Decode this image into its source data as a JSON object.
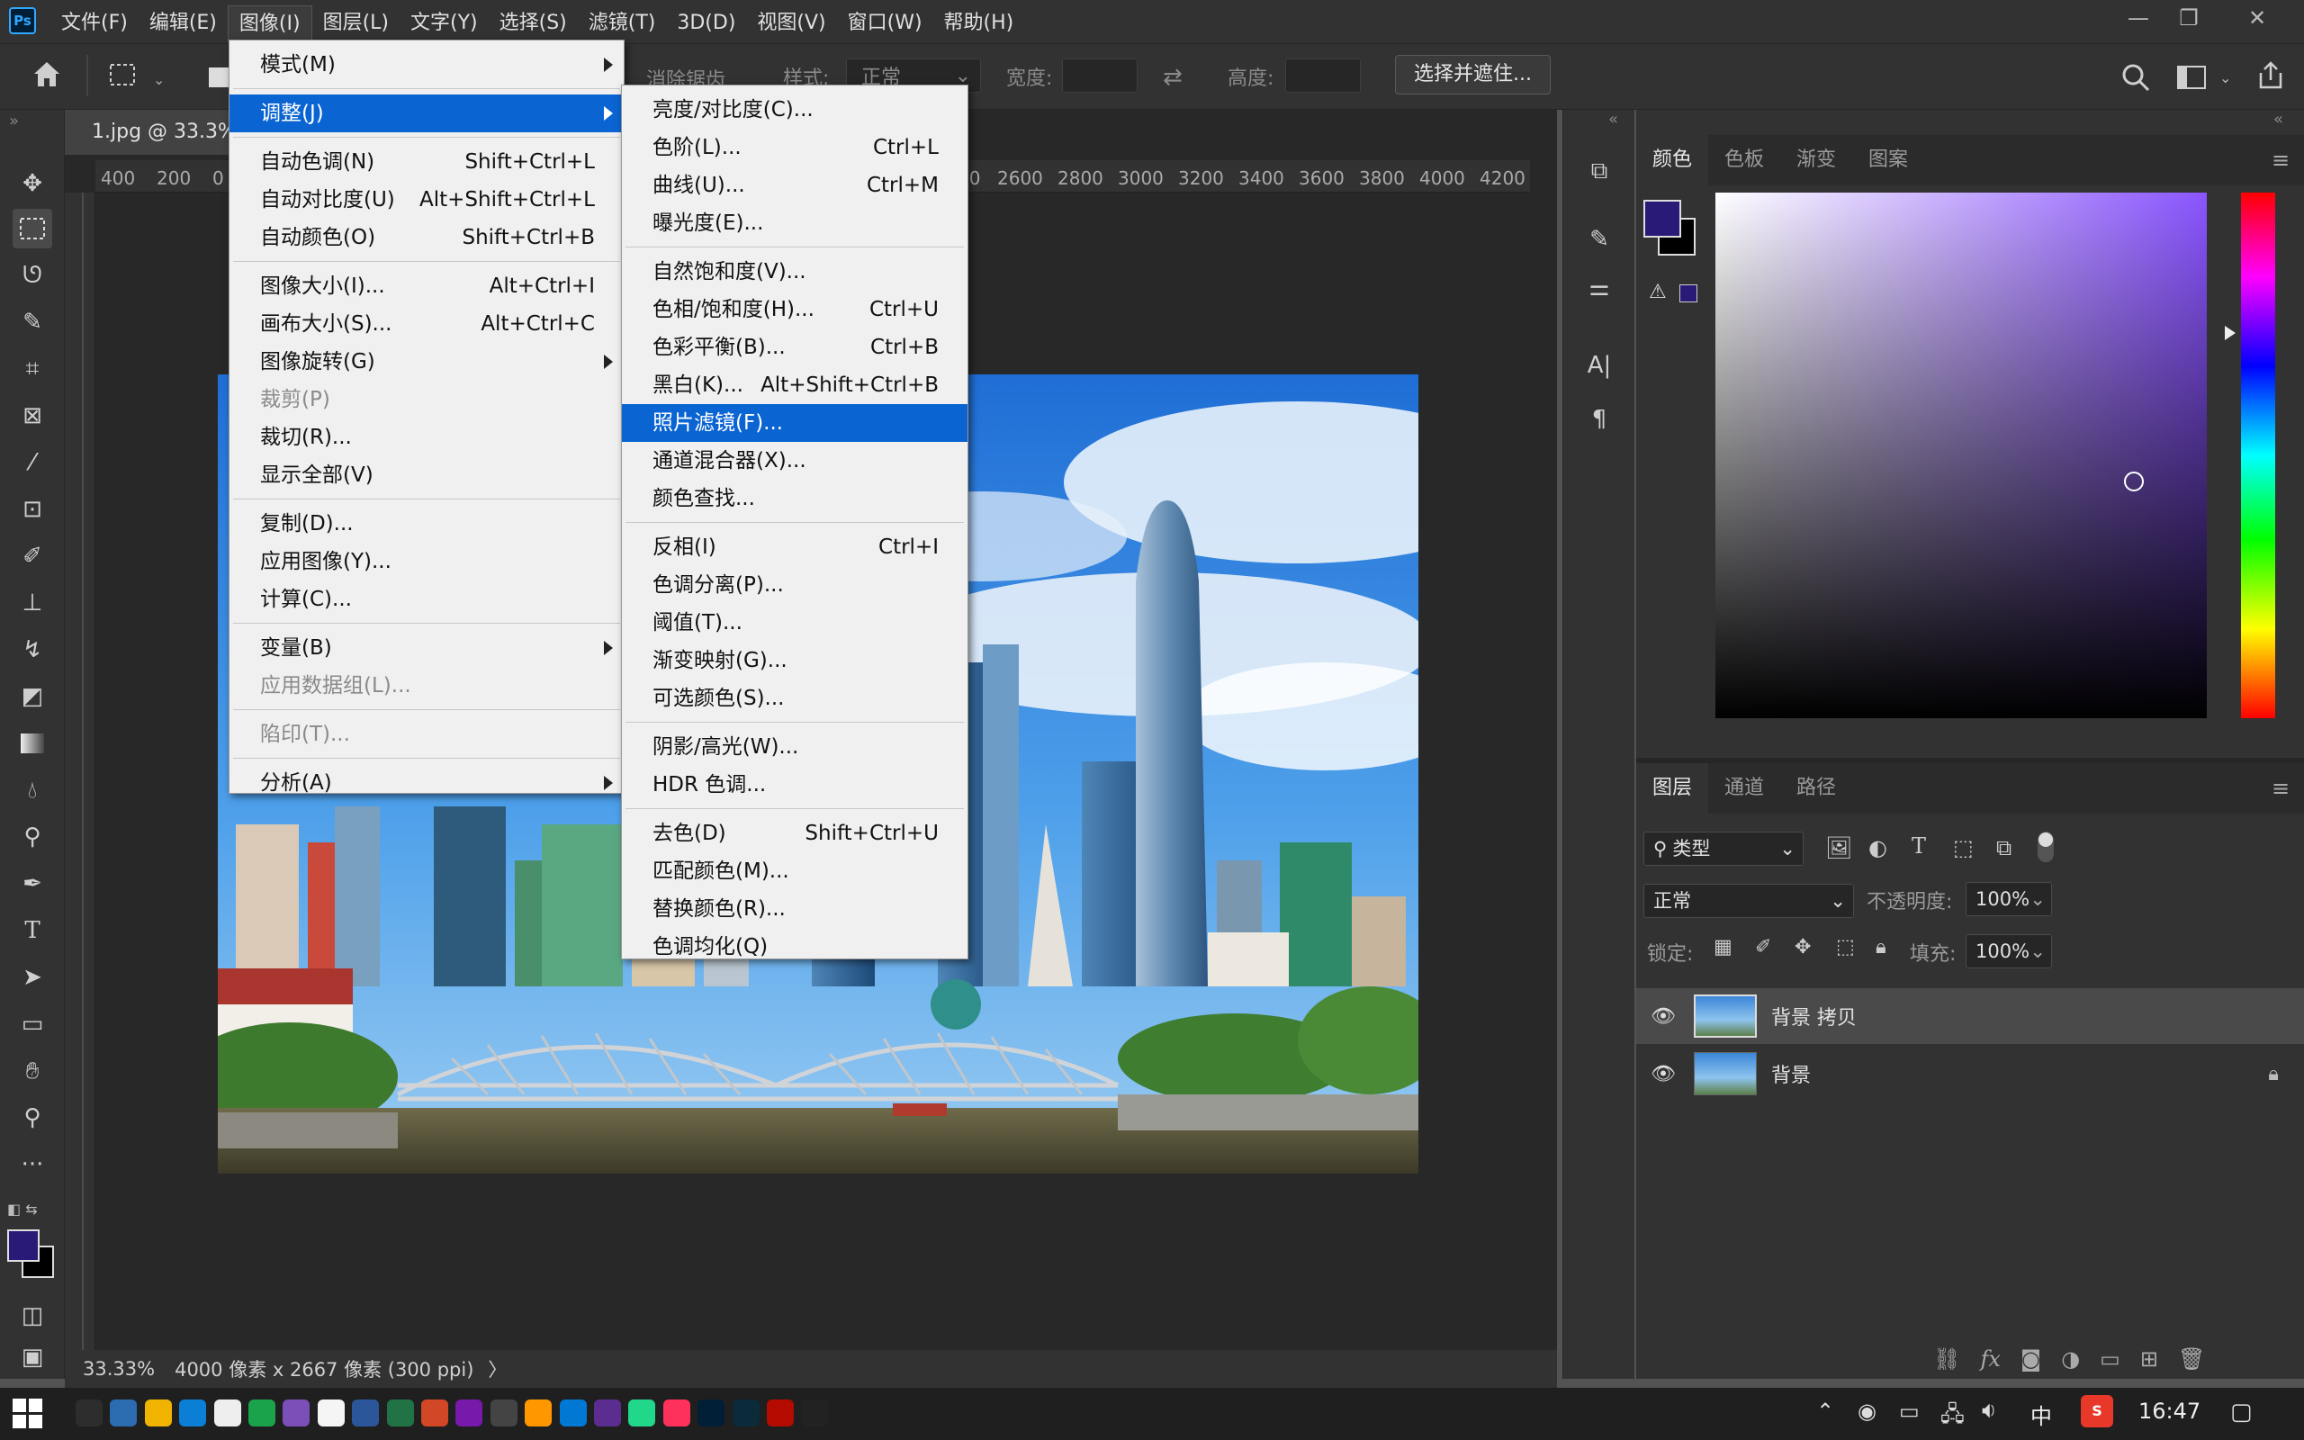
{
  "app": {
    "logo": "Ps"
  },
  "menubar": {
    "items": [
      "文件(F)",
      "编辑(E)",
      "图像(I)",
      "图层(L)",
      "文字(Y)",
      "选择(S)",
      "滤镜(T)",
      "3D(D)",
      "视图(V)",
      "窗口(W)",
      "帮助(H)"
    ],
    "active_index": 2,
    "window_controls": [
      "—",
      "❐",
      "✕"
    ]
  },
  "options": {
    "antialias_label": "消除锯齿",
    "style_label": "样式:",
    "style_value": "正常",
    "width_label": "宽度:",
    "height_label": "高度:",
    "select_mask_button": "选择并遮住..."
  },
  "document": {
    "tab_title": "1.jpg @ 33.3%",
    "ruler_left": [
      "400",
      "200",
      "0"
    ],
    "ruler_right": [
      "2600",
      "2800",
      "3000",
      "3200",
      "3400",
      "3600",
      "3800",
      "4000",
      "4200"
    ],
    "ruler_right_partial": "00",
    "zoom": "33.33%",
    "info": "4000 像素 x 2667 像素 (300 ppi)",
    "info_arrow": "〉"
  },
  "image_menu": {
    "items": [
      {
        "label": "模式(M)",
        "shortcut": "",
        "submenu": true,
        "disabled": false,
        "highlight": false
      },
      {
        "sep": true
      },
      {
        "label": "调整(J)",
        "shortcut": "",
        "submenu": true,
        "disabled": false,
        "highlight": true
      },
      {
        "sep": true
      },
      {
        "label": "自动色调(N)",
        "shortcut": "Shift+Ctrl+L",
        "submenu": false,
        "disabled": false,
        "highlight": false
      },
      {
        "label": "自动对比度(U)",
        "shortcut": "Alt+Shift+Ctrl+L",
        "submenu": false,
        "disabled": false,
        "highlight": false
      },
      {
        "label": "自动颜色(O)",
        "shortcut": "Shift+Ctrl+B",
        "submenu": false,
        "disabled": false,
        "highlight": false
      },
      {
        "sep": true
      },
      {
        "label": "图像大小(I)...",
        "shortcut": "Alt+Ctrl+I",
        "submenu": false,
        "disabled": false,
        "highlight": false
      },
      {
        "label": "画布大小(S)...",
        "shortcut": "Alt+Ctrl+C",
        "submenu": false,
        "disabled": false,
        "highlight": false
      },
      {
        "label": "图像旋转(G)",
        "shortcut": "",
        "submenu": true,
        "disabled": false,
        "highlight": false
      },
      {
        "label": "裁剪(P)",
        "shortcut": "",
        "submenu": false,
        "disabled": true,
        "highlight": false
      },
      {
        "label": "裁切(R)...",
        "shortcut": "",
        "submenu": false,
        "disabled": false,
        "highlight": false
      },
      {
        "label": "显示全部(V)",
        "shortcut": "",
        "submenu": false,
        "disabled": false,
        "highlight": false
      },
      {
        "sep": true
      },
      {
        "label": "复制(D)...",
        "shortcut": "",
        "submenu": false,
        "disabled": false,
        "highlight": false
      },
      {
        "label": "应用图像(Y)...",
        "shortcut": "",
        "submenu": false,
        "disabled": false,
        "highlight": false
      },
      {
        "label": "计算(C)...",
        "shortcut": "",
        "submenu": false,
        "disabled": false,
        "highlight": false
      },
      {
        "sep": true
      },
      {
        "label": "变量(B)",
        "shortcut": "",
        "submenu": true,
        "disabled": false,
        "highlight": false
      },
      {
        "label": "应用数据组(L)...",
        "shortcut": "",
        "submenu": false,
        "disabled": true,
        "highlight": false
      },
      {
        "sep": true
      },
      {
        "label": "陷印(T)...",
        "shortcut": "",
        "submenu": false,
        "disabled": true,
        "highlight": false
      },
      {
        "sep": true
      },
      {
        "label": "分析(A)",
        "shortcut": "",
        "submenu": true,
        "disabled": false,
        "highlight": false
      }
    ]
  },
  "adjust_menu": {
    "items": [
      {
        "label": "亮度/对比度(C)...",
        "shortcut": "",
        "highlight": false
      },
      {
        "label": "色阶(L)...",
        "shortcut": "Ctrl+L",
        "highlight": false
      },
      {
        "label": "曲线(U)...",
        "shortcut": "Ctrl+M",
        "highlight": false
      },
      {
        "label": "曝光度(E)...",
        "shortcut": "",
        "highlight": false
      },
      {
        "sep": true
      },
      {
        "label": "自然饱和度(V)...",
        "shortcut": "",
        "highlight": false
      },
      {
        "label": "色相/饱和度(H)...",
        "shortcut": "Ctrl+U",
        "highlight": false
      },
      {
        "label": "色彩平衡(B)...",
        "shortcut": "Ctrl+B",
        "highlight": false
      },
      {
        "label": "黑白(K)...",
        "shortcut": "Alt+Shift+Ctrl+B",
        "highlight": false
      },
      {
        "label": "照片滤镜(F)...",
        "shortcut": "",
        "highlight": true
      },
      {
        "label": "通道混合器(X)...",
        "shortcut": "",
        "highlight": false
      },
      {
        "label": "颜色查找...",
        "shortcut": "",
        "highlight": false
      },
      {
        "sep": true
      },
      {
        "label": "反相(I)",
        "shortcut": "Ctrl+I",
        "highlight": false
      },
      {
        "label": "色调分离(P)...",
        "shortcut": "",
        "highlight": false
      },
      {
        "label": "阈值(T)...",
        "shortcut": "",
        "highlight": false
      },
      {
        "label": "渐变映射(G)...",
        "shortcut": "",
        "highlight": false
      },
      {
        "label": "可选颜色(S)...",
        "shortcut": "",
        "highlight": false
      },
      {
        "sep": true
      },
      {
        "label": "阴影/高光(W)...",
        "shortcut": "",
        "highlight": false
      },
      {
        "label": "HDR 色调...",
        "shortcut": "",
        "highlight": false
      },
      {
        "sep": true
      },
      {
        "label": "去色(D)",
        "shortcut": "Shift+Ctrl+U",
        "highlight": false
      },
      {
        "label": "匹配颜色(M)...",
        "shortcut": "",
        "highlight": false
      },
      {
        "label": "替换颜色(R)...",
        "shortcut": "",
        "highlight": false
      },
      {
        "label": "色调均化(Q)",
        "shortcut": "",
        "highlight": false
      }
    ]
  },
  "color_panel": {
    "tabs": [
      "颜色",
      "色板",
      "渐变",
      "图案"
    ],
    "active_tab": 0,
    "foreground_color": "#2a1a78",
    "background_color": "#000000",
    "hue_color": "#8a55ff"
  },
  "layers_panel": {
    "tabs": [
      "图层",
      "通道",
      "路径"
    ],
    "filter_label": "类型",
    "blend_mode": "正常",
    "opacity_label": "不透明度:",
    "opacity_value": "100%",
    "lock_label": "锁定:",
    "fill_label": "填充:",
    "fill_value": "100%",
    "layers": [
      {
        "name": "背景 拷贝",
        "selected": true,
        "locked": false
      },
      {
        "name": "背景",
        "selected": false,
        "locked": true
      }
    ]
  },
  "taskbar": {
    "time": "16:47",
    "ime": "中",
    "apps": [
      "cmd",
      "files",
      "edge",
      "chrome",
      "pycharm",
      "typora",
      "notepad",
      "notion",
      "word",
      "excel",
      "ppt",
      "onenote",
      "dev",
      "sublime",
      "vscode",
      "vs",
      "pc",
      "idea",
      "ps",
      "lr",
      "acrobat",
      "qq"
    ]
  }
}
